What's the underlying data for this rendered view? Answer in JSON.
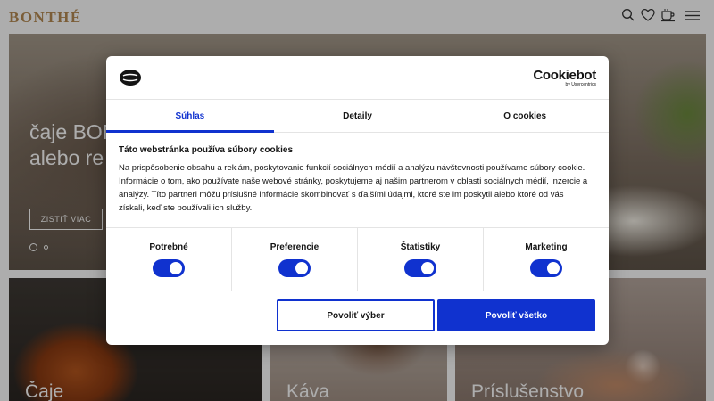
{
  "header": {
    "logo_text": "BONTHÉ",
    "icons": [
      "search-icon",
      "heart-icon",
      "cup-icon",
      "menu-icon"
    ]
  },
  "hero": {
    "title_line1": "čaje BON",
    "title_line2": "alebo re",
    "button_label": "ZISTIŤ VIAC"
  },
  "categories": [
    {
      "label": "Čaje"
    },
    {
      "label": "Káva"
    },
    {
      "label": "Príslušenstvo"
    }
  ],
  "cookie_dialog": {
    "brand_name": "Cookiebot",
    "brand_sub": "by Usercentrics",
    "tabs": [
      {
        "label": "Súhlas",
        "active": true
      },
      {
        "label": "Detaily",
        "active": false
      },
      {
        "label": "O cookies",
        "active": false
      }
    ],
    "title": "Táto webstránka používa súbory cookies",
    "text": "Na prispôsobenie obsahu a reklám, poskytovanie funkcií sociálnych médií a analýzu návštevnosti používame súbory cookie. Informácie o tom, ako používate naše webové stránky, poskytujeme aj našim partnerom v oblasti sociálnych médií, inzercie a analýzy. Títo partneri môžu príslušné informácie skombinovať s ďalšími údajmi, ktoré ste im poskytli alebo ktoré od vás získali, keď ste používali ich služby.",
    "toggles": [
      {
        "label": "Potrebné",
        "on": true
      },
      {
        "label": "Preferencie",
        "on": true
      },
      {
        "label": "Štatistiky",
        "on": true
      },
      {
        "label": "Marketing",
        "on": true
      }
    ],
    "allow_selection_label": "Povoliť výber",
    "allow_all_label": "Povoliť všetko",
    "accent_color": "#1032cf"
  }
}
